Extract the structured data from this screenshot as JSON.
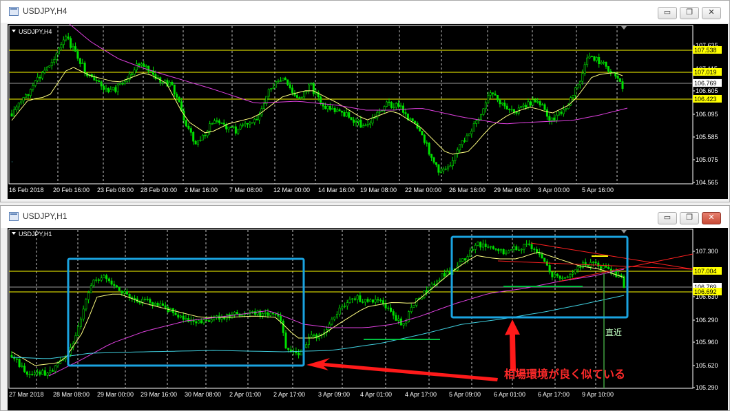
{
  "top": {
    "window_title": "USDJPY,H4",
    "chart_label": "USDJPY,H4",
    "price_labels": [
      "107.635",
      "107.115",
      "106.605",
      "106.095",
      "105.585",
      "105.075",
      "104.565"
    ],
    "highlighted_prices": [
      {
        "value": "107.538",
        "color": "#ffff00"
      },
      {
        "value": "107.019",
        "color": "#ffff00"
      },
      {
        "value": "106.769",
        "color": "#ffffff"
      },
      {
        "value": "106.423",
        "color": "#ffff00"
      }
    ],
    "time_labels": [
      "16 Feb 2018",
      "20 Feb 16:00",
      "23 Feb 08:00",
      "28 Feb 00:00",
      "2 Mar 16:00",
      "7 Mar 08:00",
      "12 Mar 00:00",
      "14 Mar 16:00",
      "19 Mar 08:00",
      "22 Mar 00:00",
      "26 Mar 16:00",
      "29 Mar 08:00",
      "3 Apr 00:00",
      "5 Apr 16:00"
    ]
  },
  "bottom": {
    "window_title": "USDJPY,H1",
    "chart_label": "USDJPY,H1",
    "price_labels": [
      "107.300",
      "106.630",
      "106.290",
      "105.960",
      "105.620",
      "105.290"
    ],
    "highlighted_prices": [
      {
        "value": "107.004",
        "color": "#ffff00"
      },
      {
        "value": "106.769",
        "color": "#ffffff"
      },
      {
        "value": "106.692",
        "color": "#ffff00"
      }
    ],
    "time_labels": [
      "27 Mar 2018",
      "28 Mar 08:00",
      "29 Mar 00:00",
      "29 Mar 16:00",
      "30 Mar 08:00",
      "2 Apr 01:00",
      "2 Apr 17:00",
      "3 Apr 09:00",
      "4 Apr 01:00",
      "4 Apr 17:00",
      "5 Apr 09:00",
      "6 Apr 01:00",
      "6 Apr 17:00",
      "9 Apr 10:00"
    ],
    "annotation_text": "相場環境が良く似ている",
    "small_label": "直近"
  },
  "window_buttons": {
    "minimize": "▭",
    "restore": "❐",
    "close": "✕"
  },
  "colors": {
    "candle": "#00e000",
    "ma_fast": "#ffff80",
    "ma_mid": "#e040e0",
    "ma_slow": "#40d0e0",
    "hline": "#ffff00",
    "box": "#1aa3e0",
    "arrow": "#ff1a1a"
  }
}
